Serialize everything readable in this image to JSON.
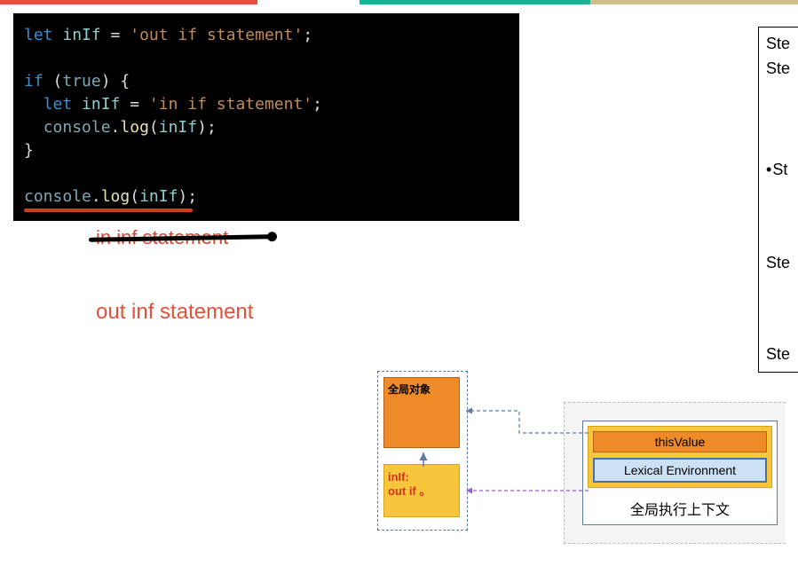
{
  "code": {
    "l1_let": "let",
    "l1_var": "inIf",
    "l1_eq": " = ",
    "l1_str": "'out if statement'",
    "l1_semi": ";",
    "l3_if": "if",
    "l3_open": " (",
    "l3_true": "true",
    "l3_close": ") {",
    "l4_ind": "  ",
    "l4_let": "let",
    "l4_var": " inIf",
    "l4_eq": " = ",
    "l4_str": "'in if statement'",
    "l4_semi": ";",
    "l5_ind": "  ",
    "l5_obj": "console",
    "l5_dot": ".",
    "l5_fn": "log",
    "l5_open": "(",
    "l5_arg": "inIf",
    "l5_close": ");",
    "l6": "}",
    "l8_obj": "console",
    "l8_dot": ".",
    "l8_fn": "log",
    "l8_open": "(",
    "l8_arg": "inIf",
    "l8_close": ");"
  },
  "output": {
    "wrong": "in inf statement",
    "right": "out inf statement"
  },
  "steps": {
    "s1": "Ste",
    "s2": "Ste",
    "s3": "St",
    "s4": "Ste",
    "s5": "Ste"
  },
  "diagram": {
    "global_object": "全局对象",
    "record_var": "inIf:",
    "record_val": "out if 。",
    "this_value": "thisValue",
    "lex_env": "Lexical Environment",
    "context_label": "全局执行上下文"
  }
}
